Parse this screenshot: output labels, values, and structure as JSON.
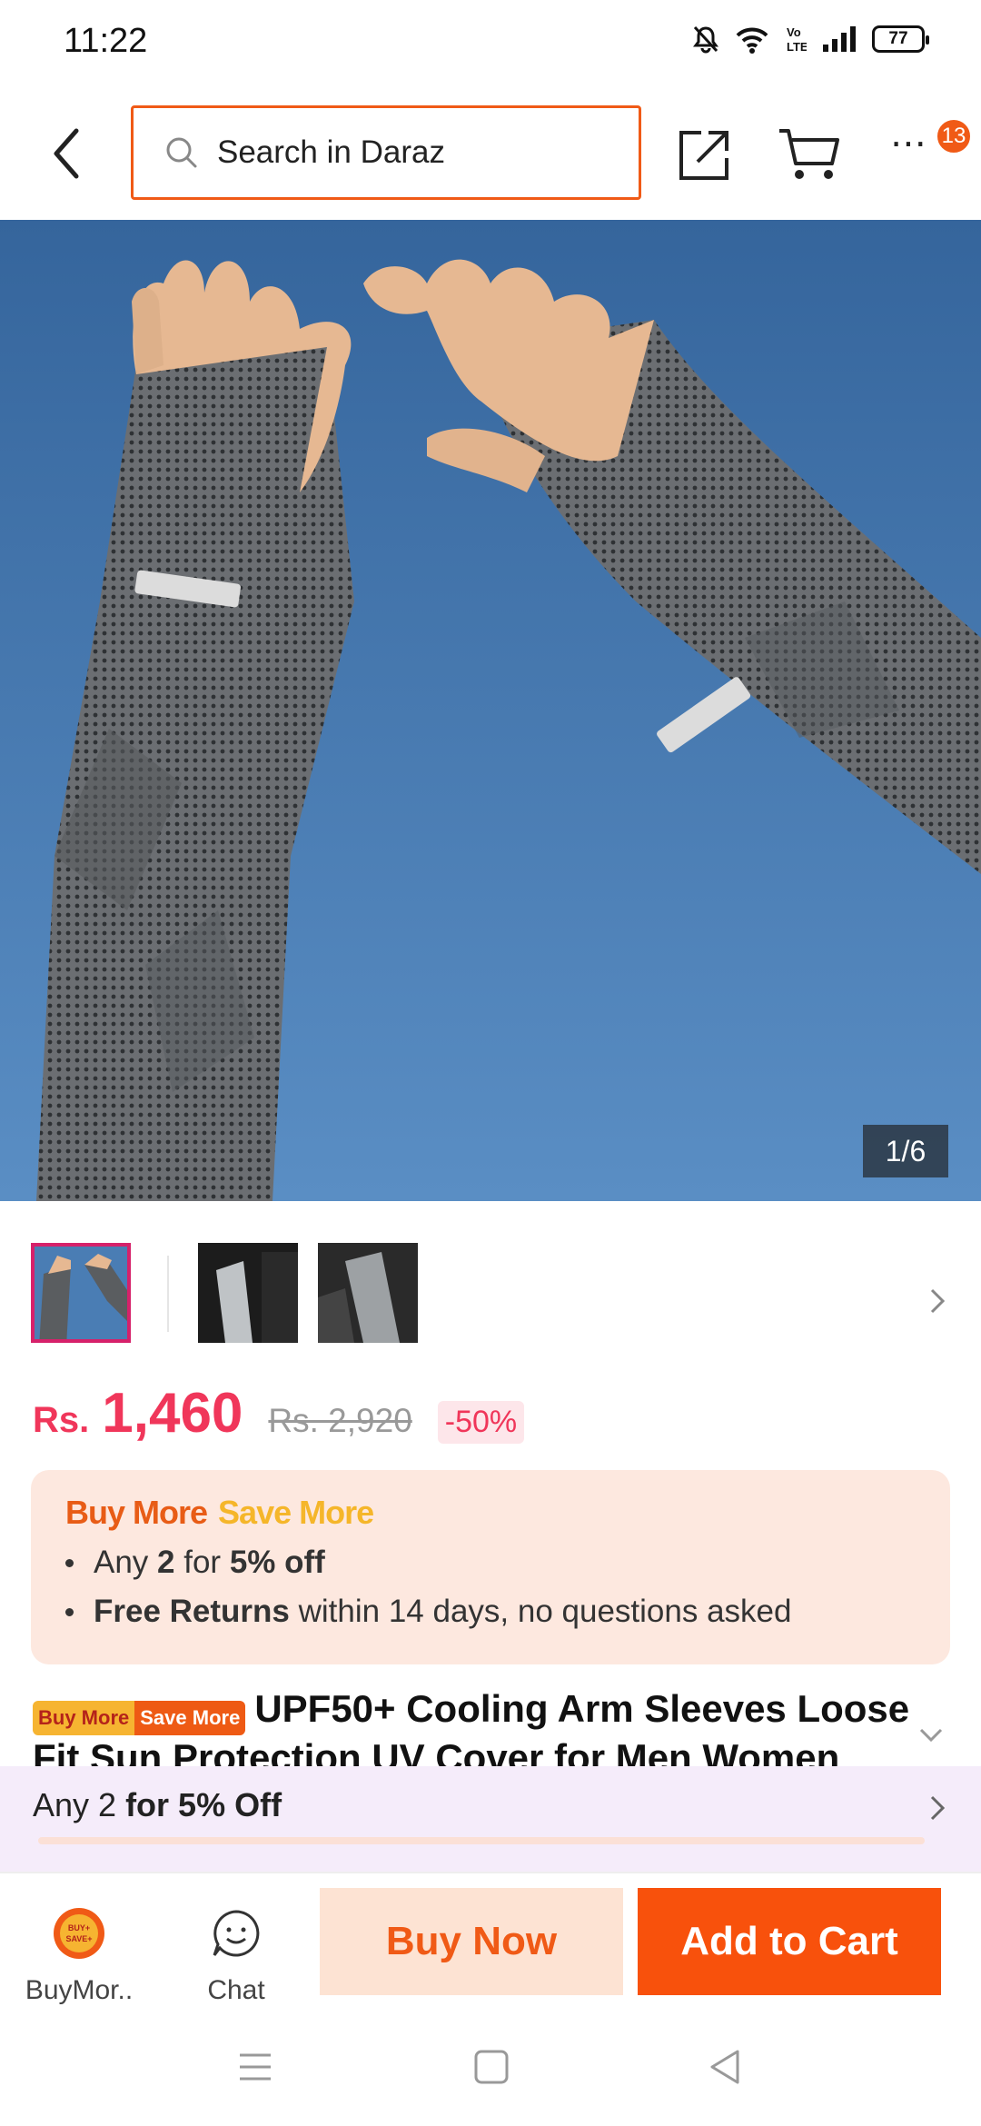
{
  "status_bar": {
    "time": "11:22",
    "battery": "77"
  },
  "header": {
    "search_placeholder": "Search in Daraz",
    "cart_badge": "13"
  },
  "gallery": {
    "counter": "1/6"
  },
  "price": {
    "currency": "Rs.",
    "amount": "1,460",
    "original": "Rs. 2,920",
    "discount": "-50%"
  },
  "promo": {
    "title_1": "Buy More",
    "title_2": "Save More",
    "line1_pre": "Any ",
    "line1_num": "2",
    "line1_mid": " for ",
    "line1_bold": "5% off",
    "line2_bold": "Free Returns",
    "line2_rest": " within 14 days, no questions asked"
  },
  "product": {
    "tag_1": "Buy More",
    "tag_2": "Save More",
    "title": "UPF50+ Cooling Arm Sleeves Loose Fit Sun Protection UV Cover for Men Women"
  },
  "offer_bar": {
    "pre": "Any 2 ",
    "bold": "for 5% Off"
  },
  "bottom_bar": {
    "buymore_label": "BuyMor..",
    "buymore_icon_text_1": "BUY+",
    "buymore_icon_text_2": "SAVE+",
    "chat_label": "Chat",
    "buy_now": "Buy Now",
    "add_to_cart": "Add to Cart"
  },
  "colors": {
    "accent": "#f05a16",
    "price": "#f0365a",
    "promo_bg": "#fde8df",
    "offer_bg": "#f5ecfa"
  }
}
